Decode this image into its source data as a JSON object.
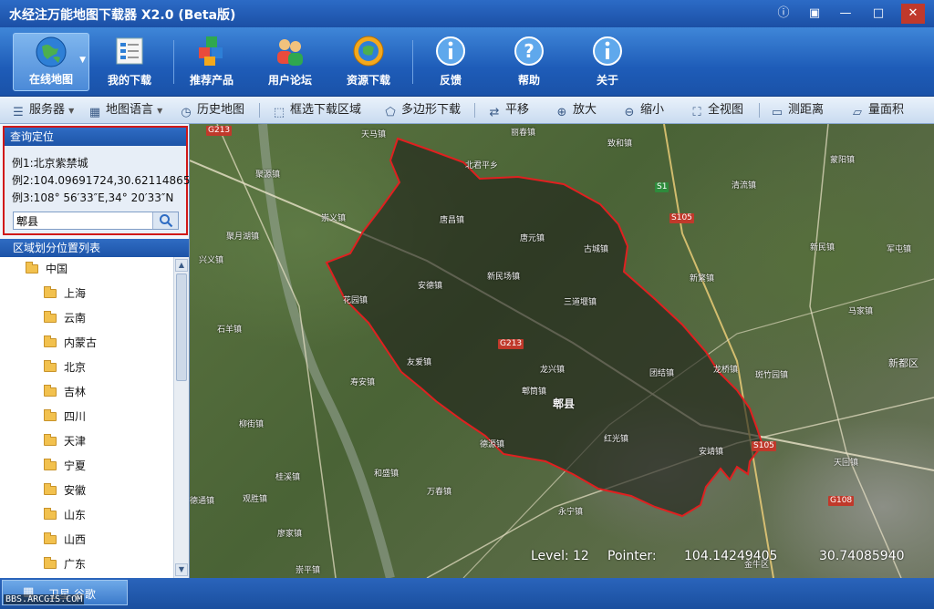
{
  "window": {
    "title": "水经注万能地图下载器 X2.0 (Beta版)",
    "buttons": [
      "ⓘ",
      "▣",
      "—",
      "□",
      "✕"
    ]
  },
  "main_toolbar": [
    {
      "label": "在线地图",
      "icon": "globe-icon",
      "active": true,
      "dropdown": true
    },
    {
      "label": "我的下载",
      "icon": "download-list-icon"
    },
    {
      "label": "推荐产品",
      "icon": "cubes-icon"
    },
    {
      "label": "用户论坛",
      "icon": "users-icon"
    },
    {
      "label": "资源下载",
      "icon": "resource-globe-icon"
    },
    {
      "label": "反馈",
      "icon": "feedback-info-icon"
    },
    {
      "label": "帮助",
      "icon": "help-icon"
    },
    {
      "label": "关于",
      "icon": "about-info-icon"
    }
  ],
  "sub_toolbar": {
    "server": "服务器",
    "map_language": "地图语言",
    "history_map": "历史地图",
    "box_download": "框选下载区域",
    "polygon_download": "多边形下载",
    "pan": "平移",
    "zoom_in": "放大",
    "zoom_out": "缩小",
    "full_view": "全视图",
    "measure_distance": "测距离",
    "measure_area": "量面积"
  },
  "query": {
    "header": "查询定位",
    "example1": "例1:北京紫禁城",
    "example2": "例2:104.09691724,30.62114865",
    "example3": "例3:108° 56′33″E,34° 20′33″N",
    "input_value": "郫县"
  },
  "region_list": {
    "header": "区域划分位置列表",
    "root": "中国",
    "items": [
      "上海",
      "云南",
      "内蒙古",
      "北京",
      "吉林",
      "四川",
      "天津",
      "宁夏",
      "安徽",
      "山东",
      "山西",
      "广东"
    ]
  },
  "map": {
    "city_label": "郫县",
    "labels": [
      "天马镇",
      "丽春镇",
      "致和镇",
      "北君平乡",
      "聚源镇",
      "崇义镇",
      "唐昌镇",
      "唐元镇",
      "清流镇",
      "蒙阳镇",
      "古城镇",
      "新民场镇",
      "新民镇",
      "军屯镇",
      "新繁镇",
      "马家镇",
      "安德镇",
      "花园镇",
      "三道堰镇",
      "兴义镇",
      "石羊镇",
      "友爱镇",
      "团结镇",
      "龙桥镇",
      "斑竹园镇",
      "新都区",
      "寿安镇",
      "龙兴镇",
      "郫筒镇",
      "德源镇",
      "红光镇",
      "安靖镇",
      "柳街镇",
      "天回镇",
      "和盛镇",
      "万春镇",
      "永宁镇",
      "桂溪镇",
      "德通镇",
      "观胜镇",
      "廖家镇",
      "崇平镇",
      "金牛区",
      "聚月湖镇"
    ],
    "roads": [
      "G213",
      "G213",
      "S1",
      "S105",
      "S105",
      "G108"
    ],
    "status": {
      "level_label": "Level:",
      "level_value": "12",
      "pointer_label": "Pointer:",
      "lon": "104.14249405",
      "lat": "30.74085940"
    }
  },
  "bottom": {
    "tab_label": "卫星.谷歌",
    "watermark": "BBS.ARCGIS.COM"
  },
  "colors": {
    "window_blue": "#1d4f9e",
    "boundary_red": "#e02020",
    "query_border": "#d01818"
  }
}
